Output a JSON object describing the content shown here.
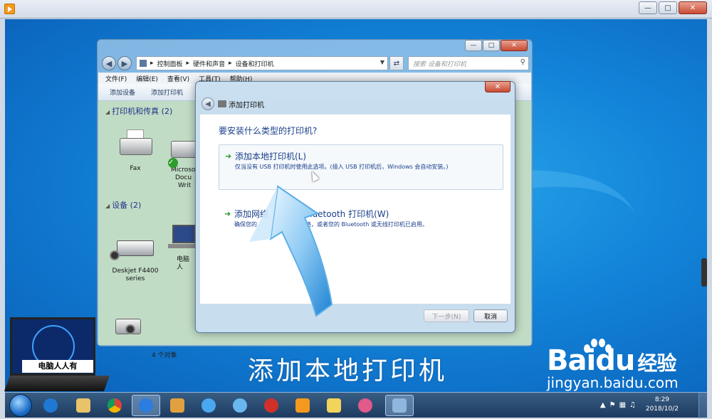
{
  "explorer": {
    "address": [
      "控制面板",
      "硬件和声音",
      "设备和打印机"
    ],
    "search_placeholder": "搜索 设备和打印机",
    "menu": [
      "文件(F)",
      "编辑(E)",
      "查看(V)",
      "工具(T)",
      "帮助(H)"
    ],
    "commands": [
      "添加设备",
      "添加打印机"
    ],
    "group_printers": "打印机和传真 (2)",
    "group_devices": "设备 (2)",
    "device_fax": "Fax",
    "device_xps": "Microsoft XPS Document Writer",
    "device_xps_l1": "Microso",
    "device_xps_l2": "Docu",
    "device_xps_l3": "Writ",
    "device_scanner_l1": "Deskjet F4400",
    "device_scanner_l2": "series",
    "device_pc": "电脑人",
    "object_count": "4 个对象"
  },
  "dialog": {
    "title": "添加打印机",
    "question": "要安装什么类型的打印机?",
    "option_local_title": "添加本地打印机(L)",
    "option_local_desc": "仅当没有 USB 打印机时使用此选项。(插入 USB 打印机后，Windows 会自动安装。)",
    "option_network_title": "添加网络、无线或 Bluetooth 打印机(W)",
    "option_network_title_a": "添加网络",
    "option_network_title_b": "Bluetooth 打印机(W)",
    "option_network_desc_a": "确保您的",
    "option_network_desc_b": "络，或者您的 Bluetooth 或无线打印机已启用。",
    "next_button": "下一步(N)",
    "cancel_button": "取消"
  },
  "overlay": {
    "caption": "添加本地打印机",
    "watermark_label": "电脑人人有",
    "baidu_brand": "Baidu",
    "baidu_brand_a": "Bai",
    "baidu_brand_b": "du",
    "baidu_jingyan": "经验",
    "baidu_url": "jingyan.baidu.com"
  },
  "taskbar": {
    "time": "8:29",
    "date": "2018/10/2",
    "apps": [
      "ie-icon",
      "explorer-icon",
      "chrome-icon",
      "app-icon",
      "paint-icon",
      "cloud-icon",
      "pinwheel-icon",
      "game-icon",
      "media-icon",
      "folder-icon",
      "mask-icon",
      "devices-window"
    ]
  },
  "colors": {
    "desktop": "#1283d8",
    "explorer_content": "#c1dcc5",
    "dialog_text": "#1a3e8a",
    "arrow": "#2f9a2f"
  }
}
